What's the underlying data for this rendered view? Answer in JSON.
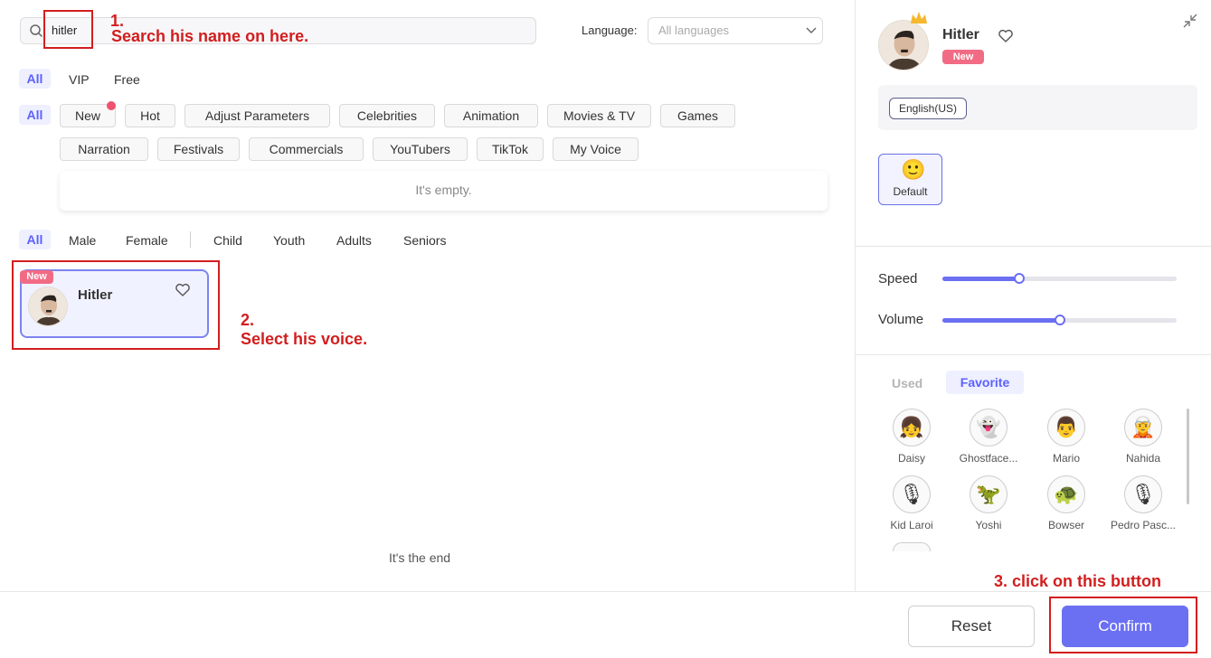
{
  "search": {
    "value": "hitler",
    "icon": "search-icon"
  },
  "language": {
    "label": "Language:",
    "placeholder": "All languages"
  },
  "tier_tabs": [
    "All",
    "VIP",
    "Free"
  ],
  "category_row1": [
    "All",
    "New",
    "Hot",
    "Adjust Parameters",
    "Celebrities",
    "Animation",
    "Movies & TV",
    "Games"
  ],
  "category_row2": [
    "Narration",
    "Festivals",
    "Commercials",
    "YouTubers",
    "TikTok",
    "My Voice"
  ],
  "empty_text": "It's empty.",
  "filter_tabs": [
    "All",
    "Male",
    "Female",
    "Child",
    "Youth",
    "Adults",
    "Seniors"
  ],
  "voice_card": {
    "badge": "New",
    "name": "Hitler"
  },
  "annotations": {
    "step1_num": "1.",
    "step1_text": "Search his name on here.",
    "step2_num": "2.",
    "step2_text": "Select his voice.",
    "step3_text": "3. click on this button"
  },
  "end_text": "It's the end",
  "right_panel": {
    "name": "Hitler",
    "badge": "New",
    "language_chip": "English(US)",
    "style_label": "Default",
    "style_emoji": "🙂",
    "speed_label": "Speed",
    "volume_label": "Volume",
    "speed_value": 0.33,
    "volume_value": 0.5,
    "tabs": {
      "used": "Used",
      "favorite": "Favorite"
    },
    "favorites": [
      {
        "name": "Daisy",
        "icon": "👧"
      },
      {
        "name": "Ghostface...",
        "icon": "👻"
      },
      {
        "name": "Mario",
        "icon": "👨"
      },
      {
        "name": "Nahida",
        "icon": "🧝"
      },
      {
        "name": "Kid Laroi",
        "icon": "🎙"
      },
      {
        "name": "Yoshi",
        "icon": "🦖"
      },
      {
        "name": "Bowser",
        "icon": "🐢"
      },
      {
        "name": "Pedro Pasc...",
        "icon": "🎙"
      }
    ]
  },
  "buttons": {
    "reset": "Reset",
    "confirm": "Confirm"
  },
  "colors": {
    "accent": "#6b6ff2",
    "annotation": "#d21e1e",
    "new_badge": "#f26b85"
  }
}
